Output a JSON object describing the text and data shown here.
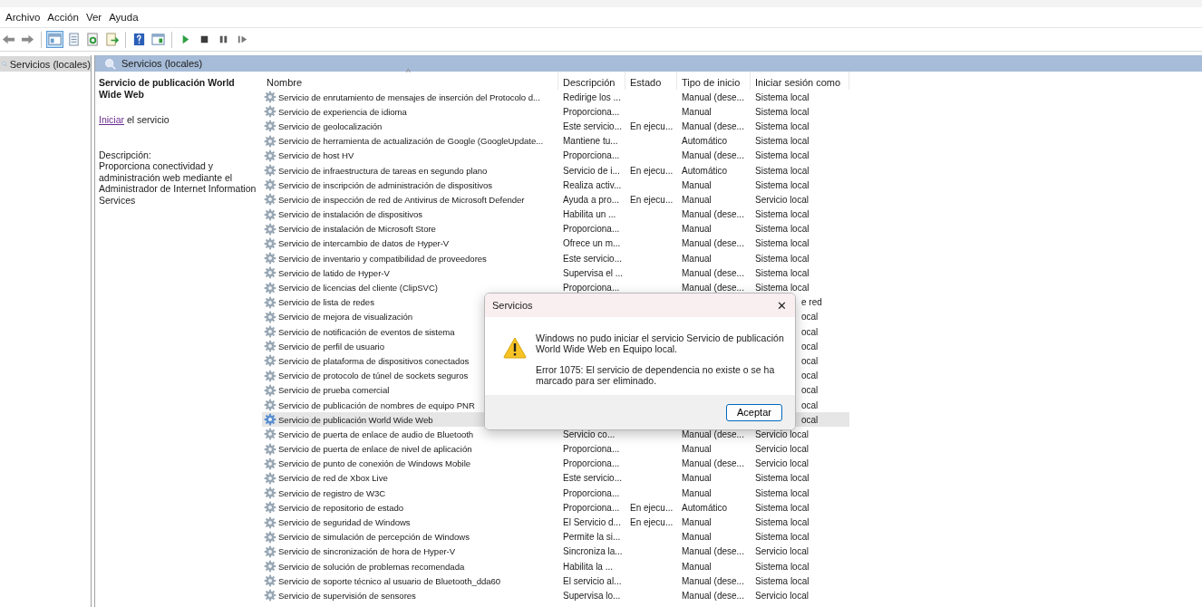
{
  "menu": [
    "Archivo",
    "Acción",
    "Ver",
    "Ayuda"
  ],
  "toolbar": [
    {
      "buttons": [
        {
          "kind": "back",
          "selected": false
        },
        {
          "kind": "forward",
          "selected": false
        }
      ]
    },
    {
      "buttons": [
        {
          "kind": "tree",
          "selected": true
        },
        {
          "kind": "properties",
          "selected": false
        },
        {
          "kind": "refresh",
          "selected": false
        },
        {
          "kind": "export",
          "selected": false
        }
      ]
    },
    {
      "buttons": [
        {
          "kind": "help",
          "selected": false
        },
        {
          "kind": "console",
          "selected": false
        }
      ]
    },
    {
      "buttons": [
        {
          "kind": "play",
          "selected": false
        },
        {
          "kind": "stop",
          "selected": false
        },
        {
          "kind": "pause",
          "selected": false
        },
        {
          "kind": "resume",
          "selected": false
        }
      ]
    }
  ],
  "tree": {
    "items": [
      {
        "label": "Servicios (locales)",
        "selected": true
      }
    ]
  },
  "header": {
    "title": "Servicios (locales)"
  },
  "details": {
    "title": "Servicio de publicación World Wide Web",
    "action_link": "Iniciar",
    "action_rest": " el servicio",
    "description_label": "Descripción:",
    "description": "Proporciona conectividad y administración web mediante el Administrador de Internet Information Services"
  },
  "table": {
    "sort_indicator": "^",
    "columns": [
      "Nombre",
      "Descripción",
      "Estado",
      "Tipo de inicio",
      "Iniciar sesión como"
    ],
    "rows": [
      {
        "kind": "full",
        "selected": false,
        "name": "Servicio de enrutamiento de mensajes de inserción del Protocolo d...",
        "description": "Redirige los ...",
        "startup": "Manual (dese...",
        "logon": "Sistema local"
      },
      {
        "kind": "full",
        "selected": false,
        "name": "Servicio de experiencia de idioma",
        "description": "Proporciona...",
        "startup": "Manual",
        "logon": "Sistema local"
      },
      {
        "kind": "full",
        "selected": false,
        "name": "Servicio de geolocalización",
        "description": "Este servicio...",
        "status": "En ejecu...",
        "startup": "Manual (dese...",
        "logon": "Sistema local"
      },
      {
        "kind": "full",
        "selected": false,
        "name": "Servicio de herramienta de actualización de Google (GoogleUpdate...",
        "description": "Mantiene tu...",
        "startup": "Automático",
        "logon": "Sistema local"
      },
      {
        "kind": "full",
        "selected": false,
        "name": "Servicio de host HV",
        "description": "Proporciona...",
        "startup": "Manual (dese...",
        "logon": "Sistema local"
      },
      {
        "kind": "full",
        "selected": false,
        "name": "Servicio de infraestructura de tareas en segundo plano",
        "description": "Servicio de i...",
        "status": "En ejecu...",
        "startup": "Automático",
        "logon": "Sistema local"
      },
      {
        "kind": "full",
        "selected": false,
        "name": "Servicio de inscripción de administración de dispositivos",
        "description": "Realiza activ...",
        "startup": "Manual",
        "logon": "Sistema local"
      },
      {
        "kind": "full",
        "selected": false,
        "name": "Servicio de inspección de red de Antivirus de Microsoft Defender",
        "description": "Ayuda a pro...",
        "status": "En ejecu...",
        "startup": "Manual",
        "logon": "Servicio local"
      },
      {
        "kind": "full",
        "selected": false,
        "name": "Servicio de instalación de dispositivos",
        "description": "Habilita un ...",
        "startup": "Manual (dese...",
        "logon": "Sistema local"
      },
      {
        "kind": "full",
        "selected": false,
        "name": "Servicio de instalación de Microsoft Store",
        "description": "Proporciona...",
        "startup": "Manual",
        "logon": "Sistema local"
      },
      {
        "kind": "full",
        "selected": false,
        "name": "Servicio de intercambio de datos de Hyper-V",
        "description": "Ofrece un m...",
        "startup": "Manual (dese...",
        "logon": "Sistema local"
      },
      {
        "kind": "full",
        "selected": false,
        "name": "Servicio de inventario y compatibilidad de proveedores",
        "description": "Este servicio...",
        "startup": "Manual",
        "logon": "Sistema local"
      },
      {
        "kind": "full",
        "selected": false,
        "name": "Servicio de latido de Hyper-V",
        "description": "Supervisa el ...",
        "startup": "Manual (dese...",
        "logon": "Sistema local"
      },
      {
        "kind": "full",
        "selected": false,
        "name": "Servicio de licencias del cliente (ClipSVC)",
        "description": "Proporciona...",
        "startup": "Manual (dese...",
        "logon": "Sistema local"
      },
      {
        "kind": "covered",
        "selected": false,
        "name": "Servicio de lista de redes",
        "logon_tail": "e red"
      },
      {
        "kind": "covered",
        "selected": false,
        "name": "Servicio de mejora de visualización",
        "logon_tail": "ocal"
      },
      {
        "kind": "covered",
        "selected": false,
        "name": "Servicio de notificación de eventos de sistema",
        "logon_tail": "ocal"
      },
      {
        "kind": "covered",
        "selected": false,
        "name": "Servicio de perfil de usuario",
        "logon_tail": "ocal"
      },
      {
        "kind": "covered",
        "selected": false,
        "name": "Servicio de plataforma de dispositivos conectados",
        "logon_tail": "ocal"
      },
      {
        "kind": "covered",
        "selected": false,
        "name": "Servicio de protocolo de túnel de sockets seguros",
        "logon_tail": "ocal"
      },
      {
        "kind": "covered",
        "selected": false,
        "name": "Servicio de prueba comercial",
        "logon_tail": "ocal"
      },
      {
        "kind": "covered",
        "selected": false,
        "name": "Servicio de publicación de nombres de equipo PNR",
        "logon_tail": "ocal"
      },
      {
        "kind": "covered",
        "selected": true,
        "name": "Servicio de publicación World Wide Web",
        "logon_tail": "ocal"
      },
      {
        "kind": "full",
        "selected": false,
        "name": "Servicio de puerta de enlace de audio de Bluetooth",
        "description": "Servicio co...",
        "startup": "Manual (dese...",
        "logon": "Servicio local"
      },
      {
        "kind": "full",
        "selected": false,
        "name": "Servicio de puerta de enlace de nivel de aplicación",
        "description": "Proporciona...",
        "startup": "Manual",
        "logon": "Servicio local"
      },
      {
        "kind": "full",
        "selected": false,
        "name": "Servicio de punto de conexión de Windows Mobile",
        "description": "Proporciona...",
        "startup": "Manual (dese...",
        "logon": "Servicio local"
      },
      {
        "kind": "full",
        "selected": false,
        "name": "Servicio de red de Xbox Live",
        "description": "Este servicio...",
        "startup": "Manual",
        "logon": "Sistema local"
      },
      {
        "kind": "full",
        "selected": false,
        "name": "Servicio de registro de W3C",
        "description": "Proporciona...",
        "startup": "Manual",
        "logon": "Sistema local"
      },
      {
        "kind": "full",
        "selected": false,
        "name": "Servicio de repositorio de estado",
        "description": "Proporciona...",
        "status": "En ejecu...",
        "startup": "Automático",
        "logon": "Sistema local"
      },
      {
        "kind": "full",
        "selected": false,
        "name": "Servicio de seguridad de Windows",
        "description": "El Servicio d...",
        "status": "En ejecu...",
        "startup": "Manual",
        "logon": "Sistema local"
      },
      {
        "kind": "full",
        "selected": false,
        "name": "Servicio de simulación de percepción de Windows",
        "description": "Permite la si...",
        "startup": "Manual",
        "logon": "Sistema local"
      },
      {
        "kind": "full",
        "selected": false,
        "name": "Servicio de sincronización de hora de Hyper-V",
        "description": "Sincroniza la...",
        "startup": "Manual (dese...",
        "logon": "Servicio local"
      },
      {
        "kind": "full",
        "selected": false,
        "name": "Servicio de solución de problemas recomendada",
        "description": "Habilita la ...",
        "startup": "Manual",
        "logon": "Sistema local"
      },
      {
        "kind": "full",
        "selected": false,
        "name": "Servicio de soporte técnico al usuario de Bluetooth_dda60",
        "description": "El servicio al...",
        "startup": "Manual (dese...",
        "logon": "Sistema local"
      },
      {
        "kind": "full",
        "selected": false,
        "name": "Servicio de supervisión de sensores",
        "description": "Supervisa lo...",
        "startup": "Manual (dese...",
        "logon": "Servicio local"
      }
    ]
  },
  "dialog": {
    "title": "Servicios",
    "close": "✕",
    "message": "Windows no pudo iniciar el servicio Servicio de publicación World Wide Web en Equipo local.",
    "error": "Error 1075: El servicio de dependencia no existe o se ha marcado para ser eliminado.",
    "button": "Aceptar"
  }
}
